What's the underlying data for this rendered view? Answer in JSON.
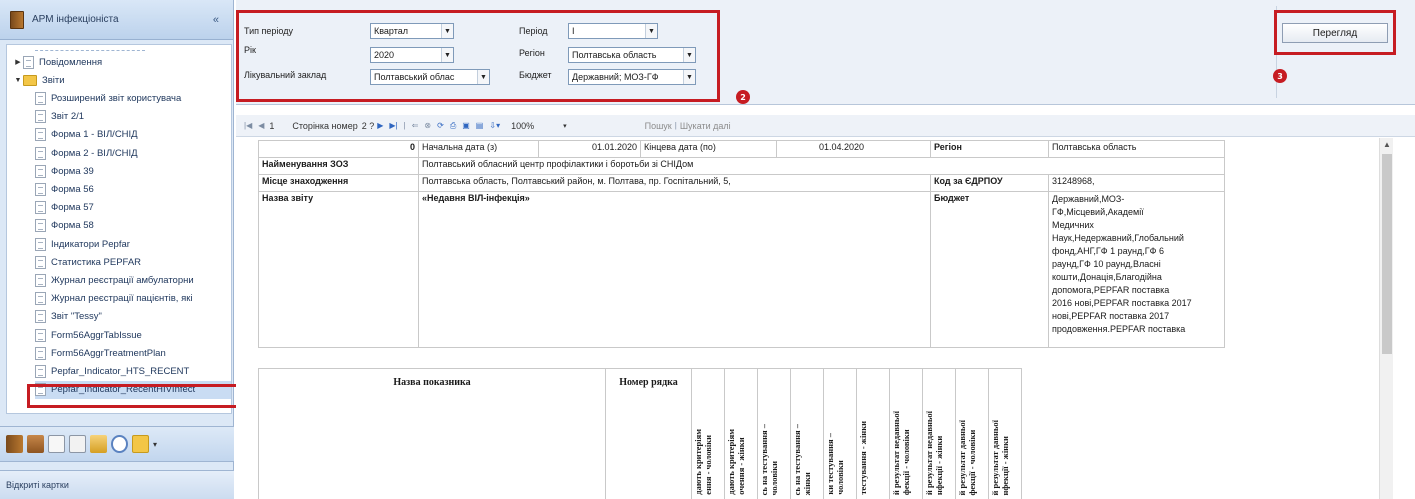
{
  "sidebar": {
    "title": "АРМ інфекціоніста",
    "collapse_icon": "double-chevron-left",
    "tree": [
      {
        "label": "Повідомлення",
        "level": 1,
        "type": "doc",
        "expandable": true
      },
      {
        "label": "Звіти",
        "level": 1,
        "type": "folder",
        "expanded": true
      },
      {
        "label": "Розширений звіт користувача",
        "level": 2,
        "type": "doc"
      },
      {
        "label": "Звіт 2/1",
        "level": 2,
        "type": "doc"
      },
      {
        "label": "Форма 1 - ВІЛ/СНІД",
        "level": 2,
        "type": "doc"
      },
      {
        "label": "Форма 2 - ВІЛ/СНІД",
        "level": 2,
        "type": "doc"
      },
      {
        "label": "Форма 39",
        "level": 2,
        "type": "doc"
      },
      {
        "label": "Форма 56",
        "level": 2,
        "type": "doc"
      },
      {
        "label": "Форма 57",
        "level": 2,
        "type": "doc"
      },
      {
        "label": "Форма 58",
        "level": 2,
        "type": "doc"
      },
      {
        "label": "Індикатори Pepfar",
        "level": 2,
        "type": "doc"
      },
      {
        "label": "Статистика PEPFAR",
        "level": 2,
        "type": "doc"
      },
      {
        "label": "Журнал реєстрації амбулаторни",
        "level": 2,
        "type": "doc"
      },
      {
        "label": "Журнал реєстрації пацієнтів, які",
        "level": 2,
        "type": "doc"
      },
      {
        "label": "Звіт \"Tessy\"",
        "level": 2,
        "type": "doc"
      },
      {
        "label": "Form56AggrTabIssue",
        "level": 2,
        "type": "doc"
      },
      {
        "label": "Form56AggrTreatmentPlan",
        "level": 2,
        "type": "doc"
      },
      {
        "label": "Pepfar_Indicator_HTS_RECENT",
        "level": 2,
        "type": "doc"
      },
      {
        "label": "Pepfar_Indicator_RecentHIVInfect",
        "level": 2,
        "type": "doc",
        "selected": true
      }
    ],
    "open_cards_label": "Відкриті картки"
  },
  "filters": {
    "period_type_label": "Тип періоду",
    "period_type_value": "Квартал",
    "year_label": "Рік",
    "year_value": "2020",
    "facility_label": "Лікувальний заклад",
    "facility_value": "Полтавський облас",
    "period_label": "Період",
    "period_value": "I",
    "region_label": "Регіон",
    "region_value": "Полтавська область",
    "budget_label": "Бюджет",
    "budget_value": "Державний; МОЗ-ГФ",
    "view_button": "Перегляд"
  },
  "annotations": [
    "1",
    "2",
    "3"
  ],
  "toolbar": {
    "page_current": "1",
    "page_number_label": "Сторінка номер",
    "page_of": "2 ?",
    "zoom": "100%",
    "search_label": "Пошук",
    "find_next_label": "Шукати далі"
  },
  "report": {
    "row1": {
      "zero": "0",
      "start_label": "Начальна дата (з)",
      "start_value": "01.01.2020",
      "end_label": "Кінцева дата (по)",
      "end_value": "01.04.2020",
      "region_label": "Регіон",
      "region_value": "Полтавська область"
    },
    "row2": {
      "label": "Найменування ЗОЗ",
      "value": "Полтавський обласний центр профілактики і боротьби зі СНІДом"
    },
    "row3": {
      "label": "Місце знаходження",
      "value": "Полтавська область, Полтавський район, м. Полтава, пр. Госпітальний, 5,",
      "code_label": "Код за ЄДРПОУ",
      "code_value": "31248968,"
    },
    "row4": {
      "label": "Назва звіту",
      "value": "«Недавня ВІЛ-інфекція»",
      "budget_label": "Бюджет",
      "budget_lines": [
        "Державний,МОЗ-",
        "ГФ,Місцевий,Академії",
        "Медичних",
        "Наук,Недержавний,Глобальний",
        "фонд,АНГ,ГФ 1 раунд,ГФ 6",
        "раунд,ГФ 10 раунд,Власні",
        "кошти,Донація,Благодійна",
        "допомога,PEPFAR поставка",
        "2016 нові,PEPFAR поставка 2017",
        "нові,PEPFAR поставка 2017",
        "продовження.PEPFAR поставка"
      ]
    },
    "indicator_name_header": "Назва показника",
    "row_number_header": "Номер рядка",
    "vertical_headers": [
      [
        "дають критеріям",
        "ення - чоловіки"
      ],
      [
        "дають критеріям",
        "очення - жінки"
      ],
      [
        "сь на тестування –",
        "чоловіки"
      ],
      [
        "сь на тестування –",
        "жінки"
      ],
      [
        "ки тестування –",
        "чоловіки"
      ],
      [
        "тестування - жінки"
      ],
      [
        "й результат недавньої",
        "фекції - чоловіки"
      ],
      [
        "й результат недавньої",
        "нфекції - жінки"
      ],
      [
        "й результат давньої",
        "фекції - чоловіки"
      ],
      [
        "й результат давньої",
        "нфекції - жінки"
      ]
    ]
  }
}
